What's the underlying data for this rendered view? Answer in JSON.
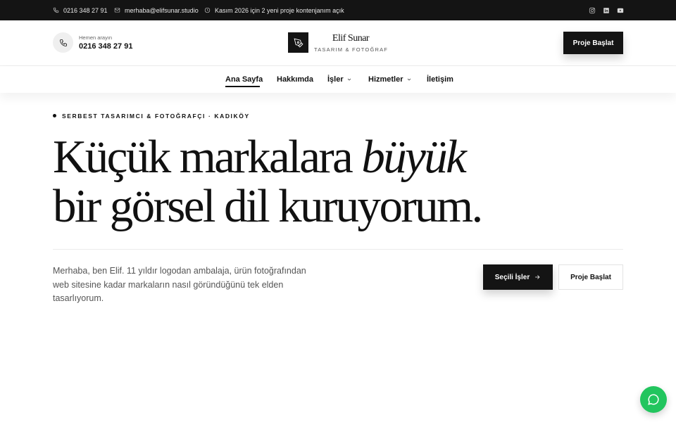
{
  "topbar": {
    "phone": "0216 348 27 91",
    "email": "merhaba@elifsunar.studio",
    "notice": "Kasım 2026 için 2 yeni proje kontenjanım açık",
    "social_icons": [
      "instagram-icon",
      "linkedin-icon",
      "youtube-icon"
    ]
  },
  "header": {
    "call_label": "Hemen arayın",
    "call_number": "0216 348 27 91",
    "brand_name": "Elif Sunar",
    "brand_tagline": "TASARIM & FOTOĞRAF",
    "cta_label": "Proje Başlat"
  },
  "nav": {
    "items": [
      {
        "label": "Ana Sayfa",
        "active": true
      },
      {
        "label": "Hakkımda"
      },
      {
        "label": "İşler",
        "dropdown": true
      },
      {
        "label": "Hizmetler",
        "dropdown": true
      },
      {
        "label": "İletişim"
      }
    ]
  },
  "hero": {
    "eyebrow": "SERBEST TASARIMCI & FOTOĞRAFÇI · KADIKÖY",
    "headline_line1": "Küçük markalara ",
    "headline_em": "büyük",
    "headline_line2": "bir görsel dil kuruyorum.",
    "lead": "Merhaba, ben Elif. 11 yıldır logodan ambalaja, ürün fotoğrafından web sitesine kadar markaların nasıl göründüğünü tek elden tasarlıyorum.",
    "primary_button": "Seçili İşler",
    "secondary_button": "Proje Başlat"
  },
  "colors": {
    "dark": "#141414",
    "accent_green": "#22c55e",
    "muted_text": "#555555"
  }
}
